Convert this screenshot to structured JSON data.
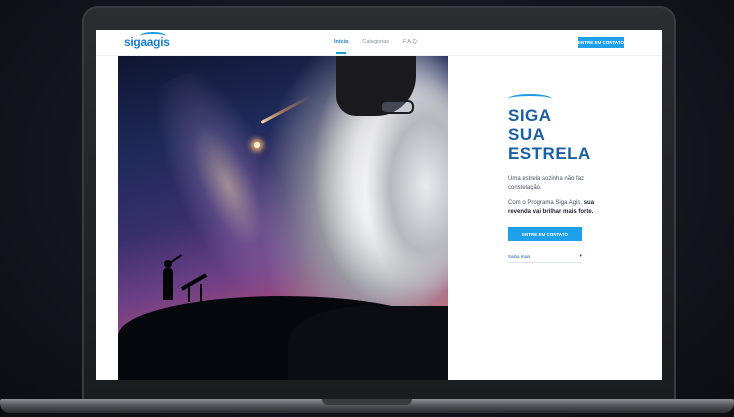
{
  "navbar": {
    "logo": "sigaagis",
    "links": [
      {
        "label": "Início",
        "active": true
      },
      {
        "label": "Categorias",
        "active": false
      },
      {
        "label": "F.A.Q.",
        "active": false
      }
    ],
    "cta_label": "ENTRE EM CONTATO"
  },
  "hero": {
    "title_lines": [
      "SIGA",
      "SUA",
      "ESTRELA"
    ],
    "description": "Uma estrela sozinha não faz constelação.",
    "description2_prefix": "Com o Programa Siga Agis,",
    "description2_bold": "sua revenda vai brilhar mais forte.",
    "cta_label": "ENTRE EM CONTATO",
    "saiba_mais": "Saiba mais",
    "saiba_arrow": "▾"
  },
  "colors": {
    "accent": "#1ea0ea",
    "title": "#1a5ea3"
  }
}
